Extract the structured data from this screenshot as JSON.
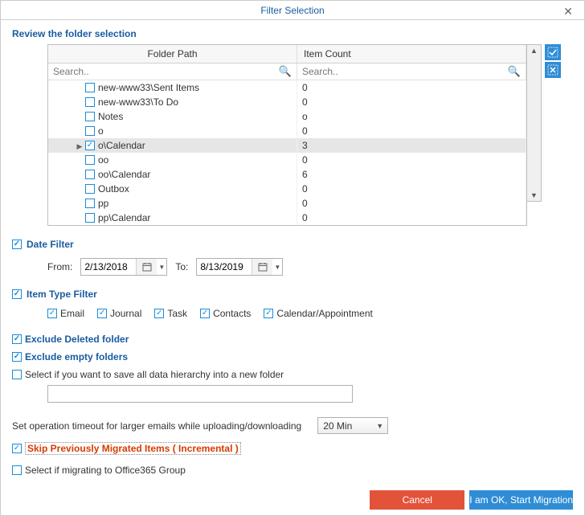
{
  "window": {
    "title": "Filter Selection"
  },
  "review_label": "Review the folder selection",
  "grid": {
    "headers": {
      "path": "Folder Path",
      "count": "Item Count"
    },
    "search_placeholder": "Search..",
    "rows": [
      {
        "path": "new-www33\\Sent Items",
        "count": "0",
        "checked": false
      },
      {
        "path": "new-www33\\To Do",
        "count": "0",
        "checked": false
      },
      {
        "path": "Notes",
        "count": "o",
        "checked": false
      },
      {
        "path": "o",
        "count": "0",
        "checked": false
      },
      {
        "path": "o\\Calendar",
        "count": "3",
        "checked": true,
        "selected": true,
        "expanded": true
      },
      {
        "path": "oo",
        "count": "0",
        "checked": false
      },
      {
        "path": "oo\\Calendar",
        "count": "6",
        "checked": false
      },
      {
        "path": "Outbox",
        "count": "0",
        "checked": false
      },
      {
        "path": "pp",
        "count": "0",
        "checked": false
      },
      {
        "path": "pp\\Calendar",
        "count": "0",
        "checked": false
      }
    ]
  },
  "date_filter": {
    "label": "Date Filter",
    "from_label": "From:",
    "to_label": "To:",
    "from": "2/13/2018",
    "to": "8/13/2019"
  },
  "item_type_filter": {
    "label": "Item Type Filter",
    "email": "Email",
    "journal": "Journal",
    "task": "Task",
    "contacts": "Contacts",
    "calendar": "Calendar/Appointment"
  },
  "exclude_deleted": "Exclude Deleted folder",
  "exclude_empty": "Exclude empty folders",
  "save_hierarchy": "Select if you want to save all data hierarchy into a new folder",
  "timeout": {
    "label": "Set operation timeout for larger emails while uploading/downloading",
    "value": "20 Min"
  },
  "skip_migrated": "Skip Previously Migrated Items ( Incremental )",
  "office365_group": "Select if migrating to Office365 Group",
  "buttons": {
    "cancel": "Cancel",
    "ok": "I am OK, Start Migration"
  }
}
